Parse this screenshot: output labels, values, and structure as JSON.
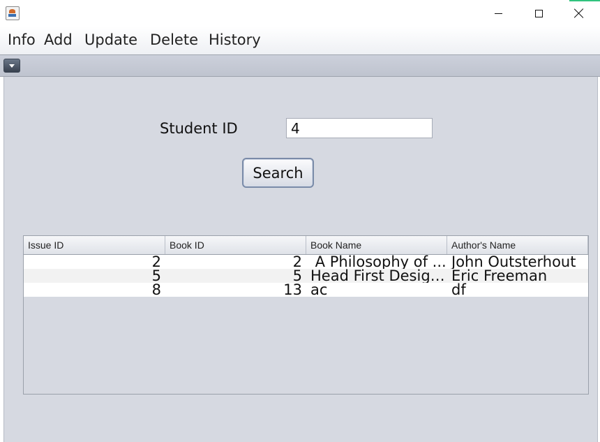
{
  "window": {
    "icon": "java-cup-icon",
    "accent_color": "#31c37e"
  },
  "menu": [
    {
      "label": "Info"
    },
    {
      "label": "Add"
    },
    {
      "label": "Update"
    },
    {
      "label": "Delete"
    },
    {
      "label": "History"
    }
  ],
  "form": {
    "student_id_label": "Student ID",
    "student_id_value": "4",
    "search_label": "Search"
  },
  "table": {
    "columns": [
      "Issue ID",
      "Book ID",
      "Book Name",
      "Author's Name"
    ],
    "rows": [
      {
        "issue_id": "2",
        "book_id": "2",
        "book_name": " A Philosophy of ...",
        "author": "John Outsterhout"
      },
      {
        "issue_id": "5",
        "book_id": "5",
        "book_name": "Head First Design...",
        "author": "Eric Freeman"
      },
      {
        "issue_id": "8",
        "book_id": "13",
        "book_name": "ac",
        "author": "df"
      }
    ]
  }
}
